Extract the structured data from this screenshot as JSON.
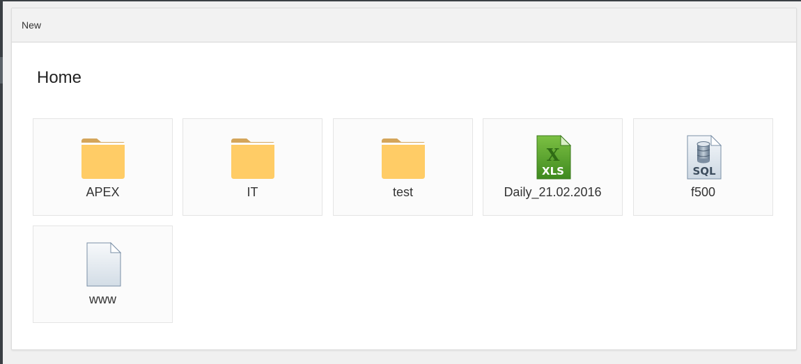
{
  "toolbar": {
    "new_label": "New"
  },
  "page": {
    "title": "Home"
  },
  "items": [
    {
      "name": "APEX",
      "type": "folder"
    },
    {
      "name": "IT",
      "type": "folder"
    },
    {
      "name": "test",
      "type": "folder"
    },
    {
      "name": "Daily_21.02.2016",
      "type": "xls",
      "badge": "XLS"
    },
    {
      "name": "f500",
      "type": "sql",
      "badge": "SQL"
    },
    {
      "name": "www",
      "type": "file"
    }
  ],
  "colors": {
    "folder": "#ffcc66",
    "folder_tab": "#d4a55a",
    "xls": "#5a9e2f",
    "sql": "#7a8fa6"
  }
}
